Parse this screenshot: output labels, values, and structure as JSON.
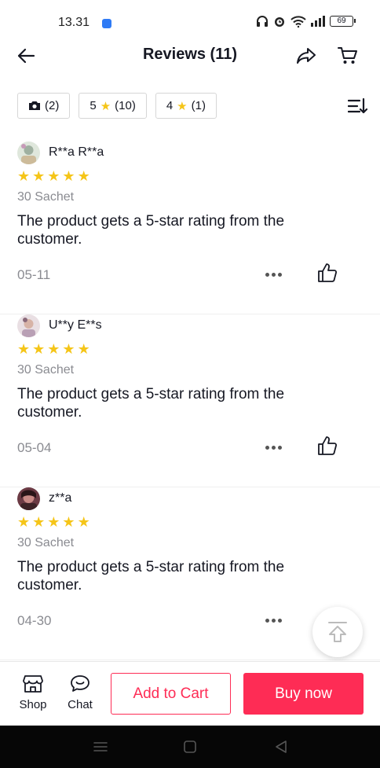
{
  "status_bar": {
    "time": "13.31",
    "battery": "69"
  },
  "header": {
    "title": "Reviews (11)"
  },
  "filters": [
    {
      "icon": "camera-icon",
      "label": "(2)"
    },
    {
      "stars": "5",
      "label": "(10)"
    },
    {
      "stars": "4",
      "label": "(1)"
    }
  ],
  "reviews": [
    {
      "user": "R**a R**a",
      "variant": "30 Sachet",
      "text": "The product gets a 5-star rating from the customer.",
      "date": "05-11",
      "rating": 5
    },
    {
      "user": "U**y E**s",
      "variant": "30 Sachet",
      "text": "The product gets a 5-star rating from the customer.",
      "date": "05-04",
      "rating": 5
    },
    {
      "user": "z**a",
      "variant": "30 Sachet",
      "text": "The product gets a 5-star rating from the customer.",
      "date": "04-30",
      "rating": 5
    }
  ],
  "bottom_bar": {
    "shop_label": "Shop",
    "chat_label": "Chat",
    "add_to_cart": "Add to Cart",
    "buy_now": "Buy now"
  },
  "colors": {
    "accent": "#fe2c55",
    "star": "#f5c518",
    "muted": "#8a8b91"
  }
}
